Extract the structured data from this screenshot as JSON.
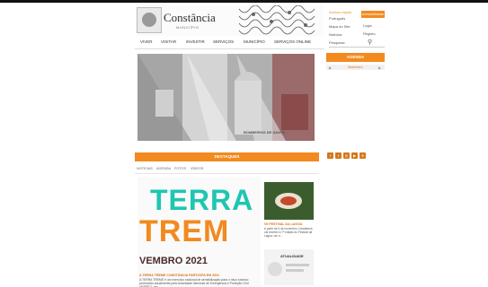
{
  "site": {
    "title": "Constância",
    "subtitle": "MUNICÍPIO"
  },
  "nav": [
    "VIVER",
    "VISITAR",
    "INVESTIR",
    "SERVIÇOS",
    "MUNICÍPIO",
    "SERVIÇOS ONLINE"
  ],
  "sidebar": {
    "access_label": "Acesso rápido",
    "access_items": [
      "Português",
      "Mapa do Site",
      "Notícias"
    ],
    "user_items": [
      "Acessibilidade",
      "Login",
      "Registo"
    ],
    "search_placeholder": "Pesquisar",
    "agenda_label": "AGENDA",
    "agenda_month": "Novembro"
  },
  "banner": {
    "sign_text": "BOMBEIROS DE SANTO"
  },
  "highlights": {
    "title": "DESTAQUES",
    "tabs": [
      "NOTÍCIAS",
      "AGENDA",
      "FOTOS",
      "VÍDEOS"
    ],
    "main": {
      "headline_line1": "TERRA",
      "headline_line2": "TREM",
      "date": "VEMBRO 2021",
      "caption": "A TERRA TREME CONSTÂNCIA PARTICIPA EM 2021",
      "text": "A TERRA TREME é um exercício nacional de sensibilização para o risco sísmico promovido anualmente pela Autoridade Nacional de Emergência e Proteção Civil (ANEPC), em"
    },
    "side_top": {
      "caption": "VII FESTIVAL DA LAGOA",
      "text": "A partir de 6 de novembro Constância vai receber a 7ª edição do Festival da Lagoa, um e..."
    },
    "side_bottom": {
      "caption": "ATUALIDADE"
    }
  },
  "colors": {
    "accent": "#f28a1f",
    "dark": "#222222"
  }
}
